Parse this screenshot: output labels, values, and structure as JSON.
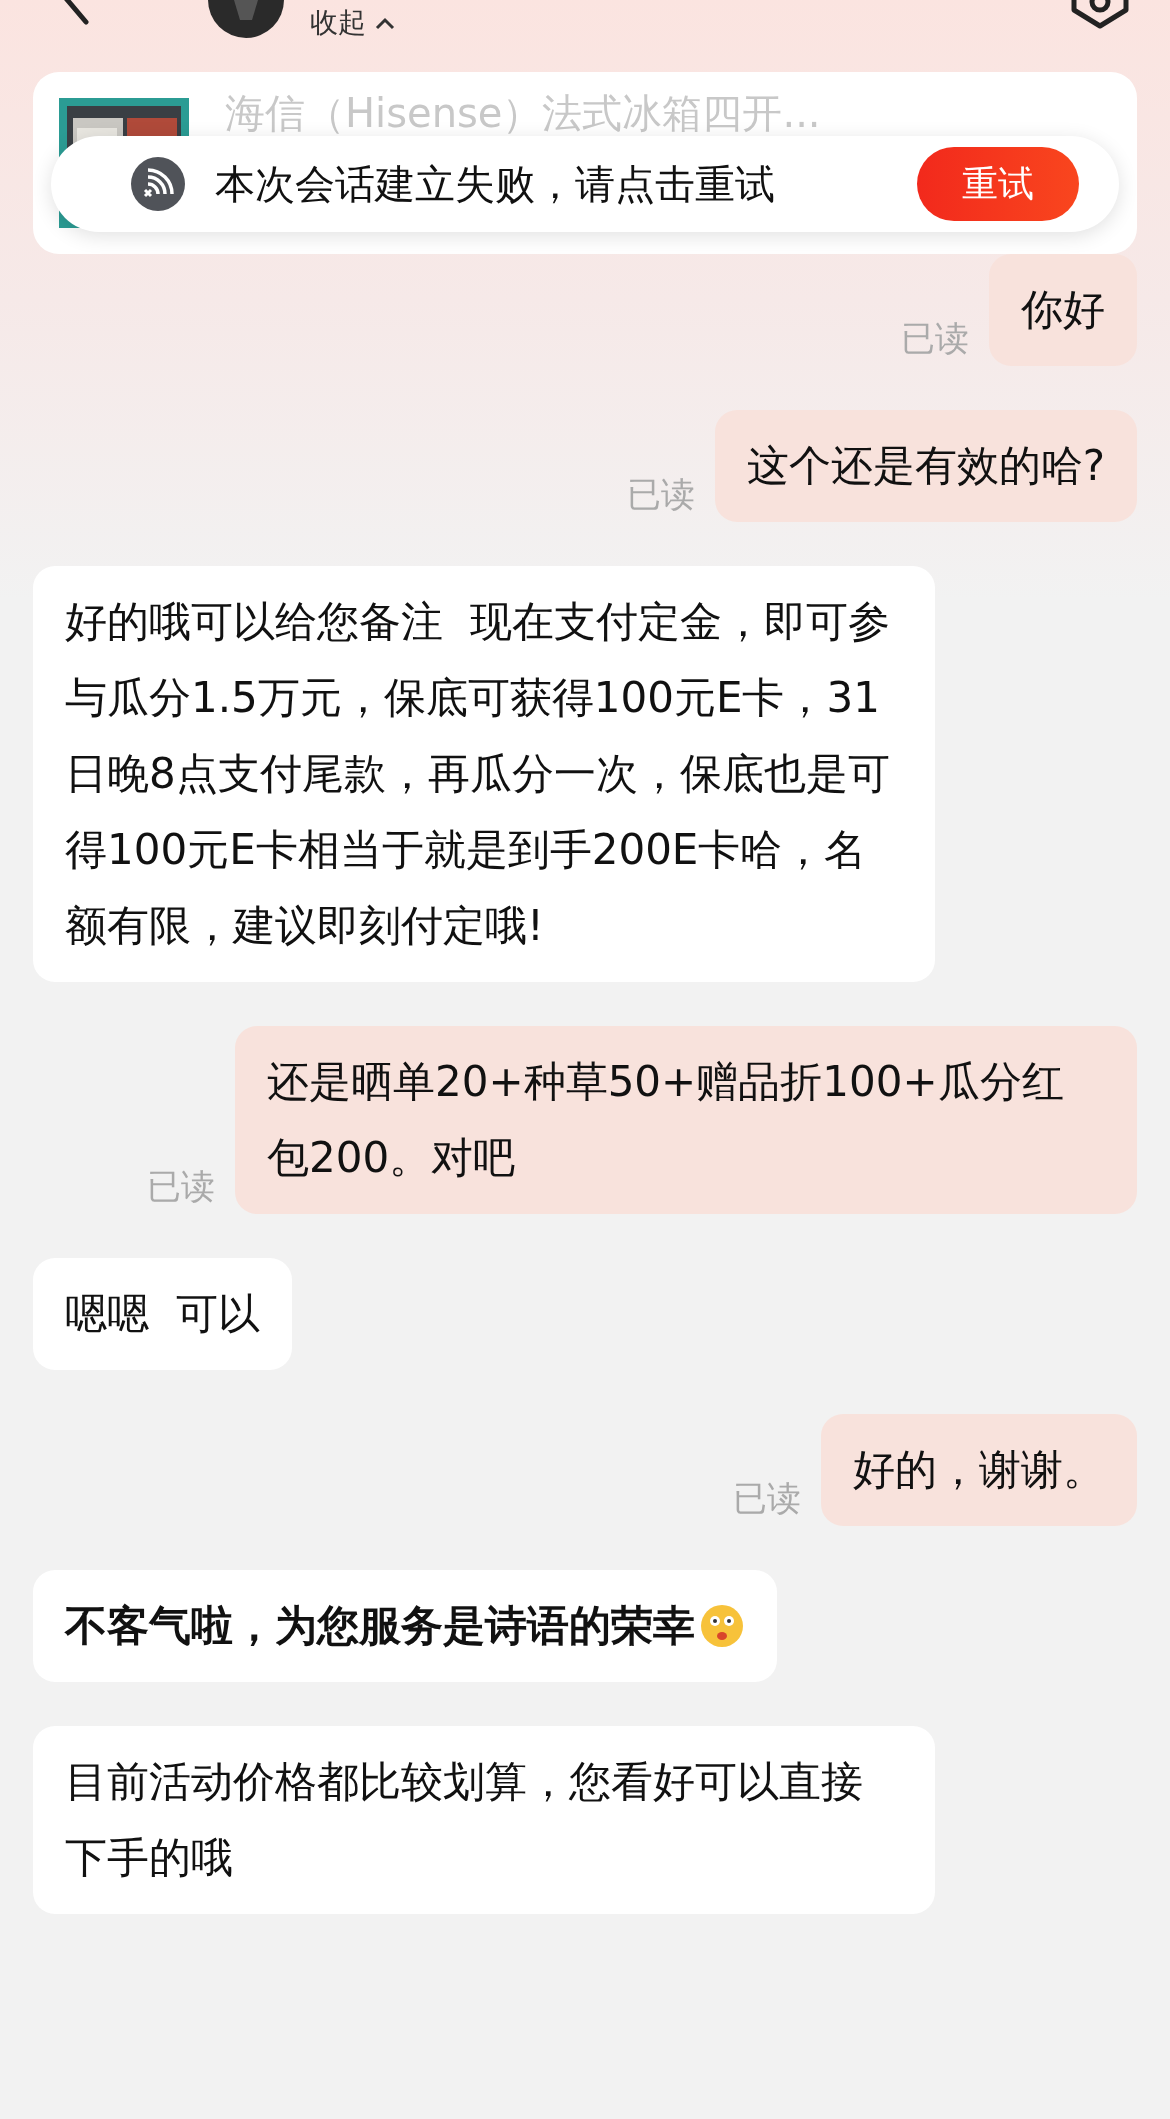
{
  "header": {
    "collapse_label": "收起"
  },
  "product": {
    "title": "海信（Hisense）法式冰箱四开..."
  },
  "toast": {
    "message": "本次会话建立失败，请点击重试",
    "retry_label": "重试"
  },
  "messages": [
    {
      "kind": "sent",
      "text": "你好",
      "read_label": "已读"
    },
    {
      "kind": "sent",
      "text": "这个还是有效的哈?",
      "read_label": "已读"
    },
    {
      "kind": "received",
      "text": "好的哦可以给您备注  现在支付定金，即可参与瓜分1.5万元，保底可获得100元E卡，31日晚8点支付尾款，再瓜分一次，保底也是可得100元E卡相当于就是到手200E卡哈，名额有限，建议即刻付定哦!"
    },
    {
      "kind": "sent",
      "text": "还是晒单20+种草50+赠品折100+瓜分红包200。对吧",
      "read_label": "已读"
    },
    {
      "kind": "received",
      "text": "嗯嗯  可以"
    },
    {
      "kind": "sent",
      "text": "好的，谢谢。",
      "read_label": "已读"
    },
    {
      "kind": "received",
      "text": "不客气啦，为您服务是诗语的荣幸",
      "bold": true,
      "emoji": true
    },
    {
      "kind": "received",
      "text": "目前活动价格都比较划算，您看好可以直接下手的哦"
    }
  ]
}
